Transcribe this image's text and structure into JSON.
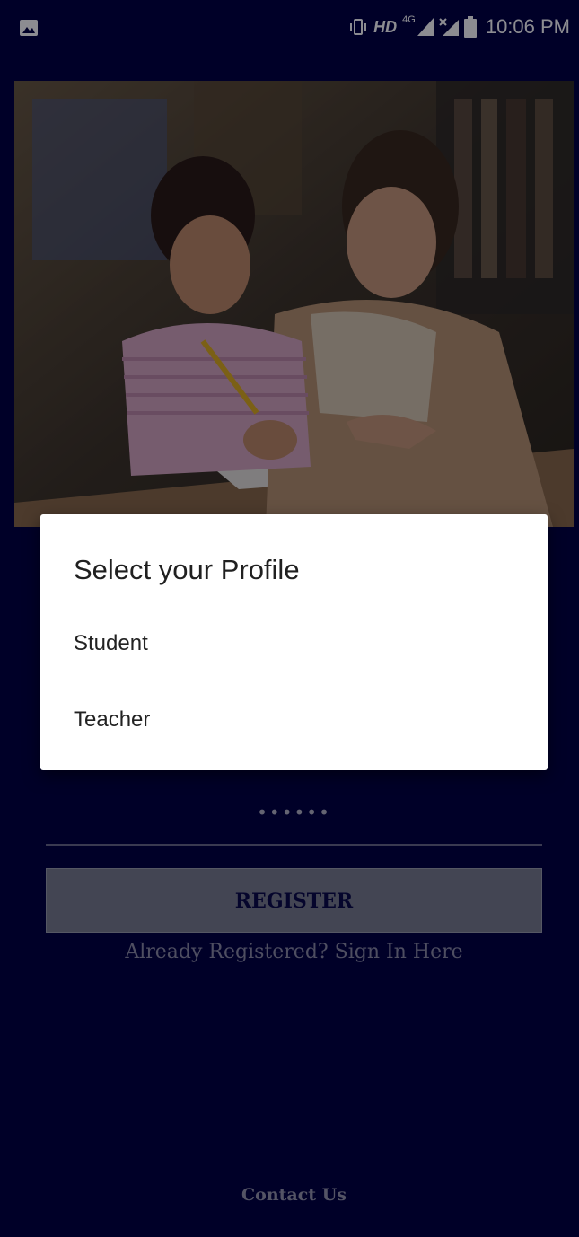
{
  "status_bar": {
    "left_icon": "image-icon",
    "indicators": [
      "vibrate-icon",
      "HD",
      "4G",
      "signal-icon",
      "no-signal-icon",
      "battery-icon"
    ],
    "hd_label": "HD",
    "network_label": "4G",
    "time": "10:06 PM"
  },
  "hero": {
    "image_description": "teacher-and-student-photo"
  },
  "form": {
    "password_value": "••••••",
    "register_label": "REGISTER",
    "signin_link": "Already Registered? Sign In Here",
    "contact_link": "Contact Us"
  },
  "dialog": {
    "title": "Select your Profile",
    "options": [
      {
        "label": "Student"
      },
      {
        "label": "Teacher"
      }
    ]
  },
  "colors": {
    "background": "#000040",
    "dialog_background": "#ffffff",
    "register_button": "#7b7f8e",
    "register_text": "#0a0a48"
  }
}
